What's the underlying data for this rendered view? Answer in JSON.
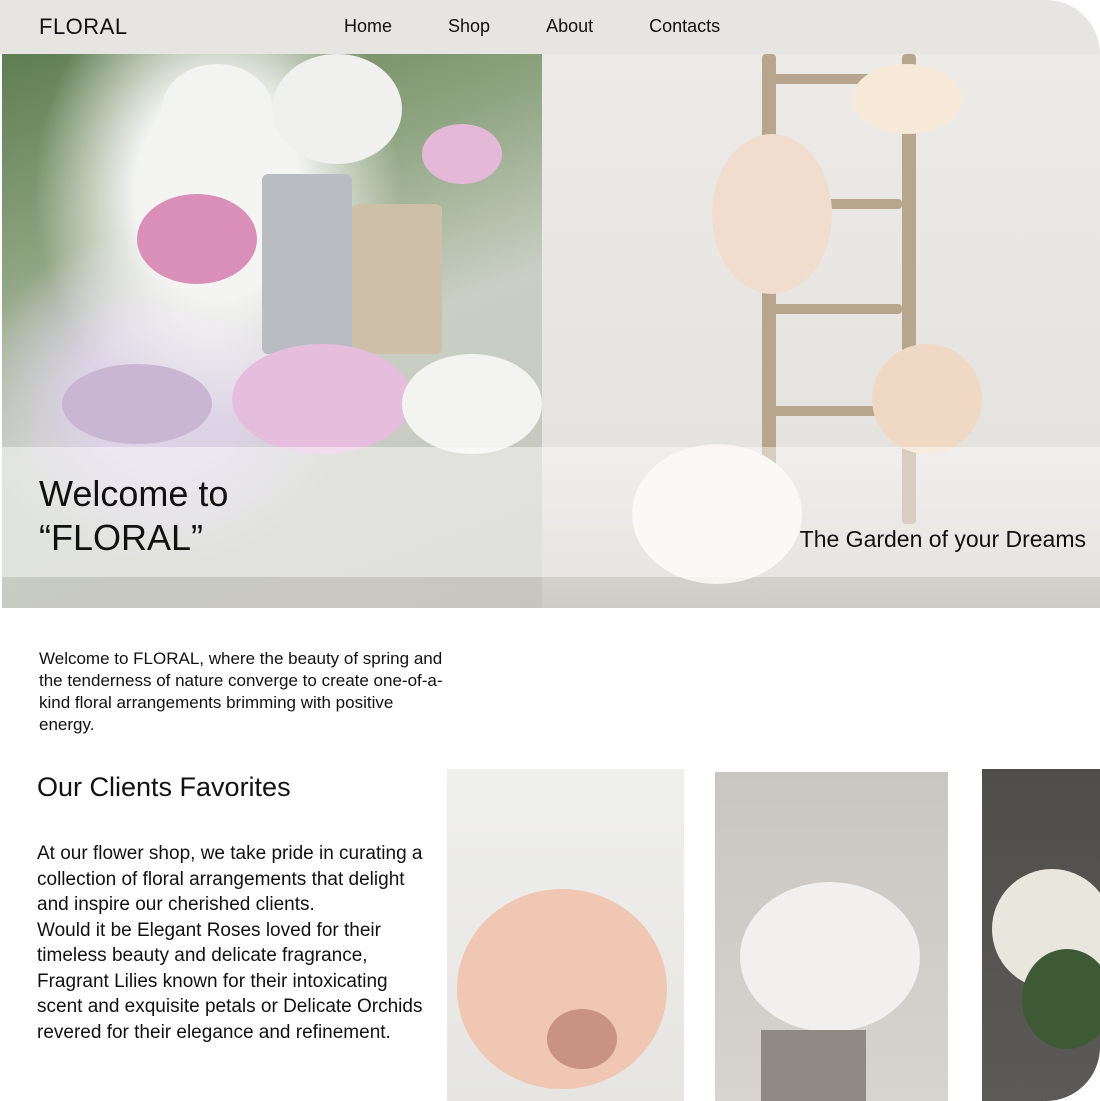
{
  "header": {
    "logo": "FLORAL",
    "nav": [
      "Home",
      "Shop",
      "About",
      "Contacts"
    ]
  },
  "hero": {
    "title": "Welcome to\n“FLORAL”",
    "tagline": "The Garden of your Dreams"
  },
  "intro": "Welcome to FLORAL, where the beauty of spring and the tenderness of nature converge to create one-of-a-kind floral arrangements brimming with positive energy.",
  "favorites": {
    "heading": "Our Clients Favorites",
    "description": "At our flower shop, we take pride in curating a collection of floral arrangements that delight and inspire our cherished clients.\nWould it be Elegant Roses loved for their timeless beauty and delicate fragrance, Fragrant Lilies known  for their intoxicating scent and exquisite petals or Delicate Orchids revered for their elegance and refinement."
  }
}
